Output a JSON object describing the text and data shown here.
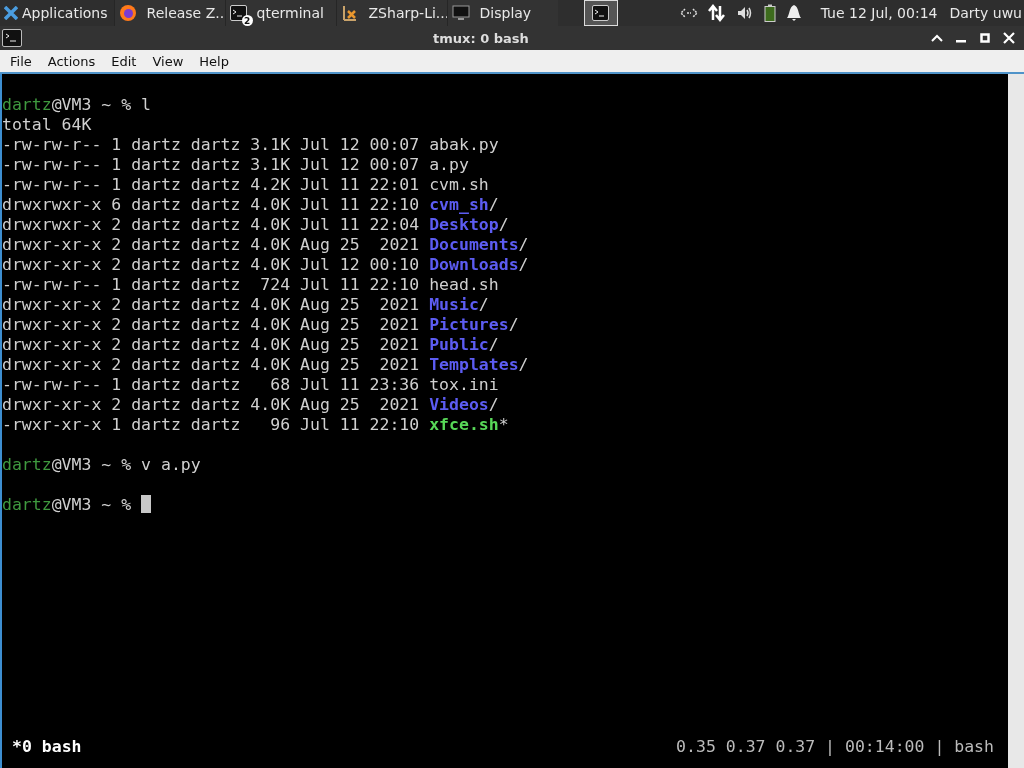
{
  "taskbar": {
    "menu": "Applications",
    "tasks": [
      {
        "kind": "firefox",
        "label": "Release Z...",
        "selected": false
      },
      {
        "kind": "terminal",
        "label": "qterminal",
        "badge": "2",
        "selected": false
      },
      {
        "kind": "editor",
        "label": "ZSharp-Li...",
        "selected": false
      },
      {
        "kind": "monitor",
        "label": "Display",
        "selected": false
      },
      {
        "kind": "terminal",
        "selected": true
      }
    ],
    "clock": "Tue 12 Jul, 00:14",
    "user": "Darty uwu"
  },
  "window": {
    "title": "tmux: 0 bash"
  },
  "menu": [
    "File",
    "Actions",
    "Edit",
    "View",
    "Help"
  ],
  "terminal": {
    "lines": [
      {
        "kind": "prompt",
        "user": "dartz",
        "host": "@VM3 ~ %",
        "command": "l"
      },
      {
        "kind": "text",
        "text": "total 64K"
      },
      {
        "kind": "file_entry",
        "info": "-rw-rw-r-- 1 dartz dartz 3.1K Jul 12 00:07",
        "name": "abak.py"
      },
      {
        "kind": "file_entry",
        "info": "-rw-rw-r-- 1 dartz dartz 3.1K Jul 12 00:07",
        "name": "a.py"
      },
      {
        "kind": "file_entry",
        "info": "-rw-rw-r-- 1 dartz dartz 4.2K Jul 11 22:01",
        "name": "cvm.sh"
      },
      {
        "kind": "dir_entry",
        "info": "drwxrwxr-x 6 dartz dartz 4.0K Jul 11 22:10",
        "name": "cvm_sh",
        "suffix": "/"
      },
      {
        "kind": "dir_entry",
        "info": "drwxrwxr-x 2 dartz dartz 4.0K Jul 11 22:04",
        "name": "Desktop",
        "suffix": "/"
      },
      {
        "kind": "dir_entry",
        "info": "drwxr-xr-x 2 dartz dartz 4.0K Aug 25  2021",
        "name": "Documents",
        "suffix": "/"
      },
      {
        "kind": "dir_entry",
        "info": "drwxr-xr-x 2 dartz dartz 4.0K Jul 12 00:10",
        "name": "Downloads",
        "suffix": "/"
      },
      {
        "kind": "file_entry",
        "info": "-rw-rw-r-- 1 dartz dartz  724 Jul 11 22:10",
        "name": "head.sh"
      },
      {
        "kind": "dir_entry",
        "info": "drwxr-xr-x 2 dartz dartz 4.0K Aug 25  2021",
        "name": "Music",
        "suffix": "/"
      },
      {
        "kind": "dir_entry",
        "info": "drwxr-xr-x 2 dartz dartz 4.0K Aug 25  2021",
        "name": "Pictures",
        "suffix": "/"
      },
      {
        "kind": "dir_entry",
        "info": "drwxr-xr-x 2 dartz dartz 4.0K Aug 25  2021",
        "name": "Public",
        "suffix": "/"
      },
      {
        "kind": "dir_entry",
        "info": "drwxr-xr-x 2 dartz dartz 4.0K Aug 25  2021",
        "name": "Templates",
        "suffix": "/"
      },
      {
        "kind": "file_entry",
        "info": "-rw-rw-r-- 1 dartz dartz   68 Jul 11 23:36",
        "name": "tox.ini"
      },
      {
        "kind": "dir_entry",
        "info": "drwxr-xr-x 2 dartz dartz 4.0K Aug 25  2021",
        "name": "Videos",
        "suffix": "/"
      },
      {
        "kind": "exec_entry",
        "info": "-rwxr-xr-x 1 dartz dartz   96 Jul 11 22:10",
        "name": "xfce.sh",
        "suffix": "*"
      },
      {
        "kind": "blank"
      },
      {
        "kind": "prompt",
        "user": "dartz",
        "host": "@VM3 ~ %",
        "command": "v a.py"
      },
      {
        "kind": "blank"
      },
      {
        "kind": "prompt",
        "user": "dartz",
        "host": "@VM3 ~ %",
        "cursor": true
      }
    ],
    "status": {
      "window": "*0 bash",
      "right": "0.35 0.37 0.37 | 00:14:00 | bash"
    }
  }
}
